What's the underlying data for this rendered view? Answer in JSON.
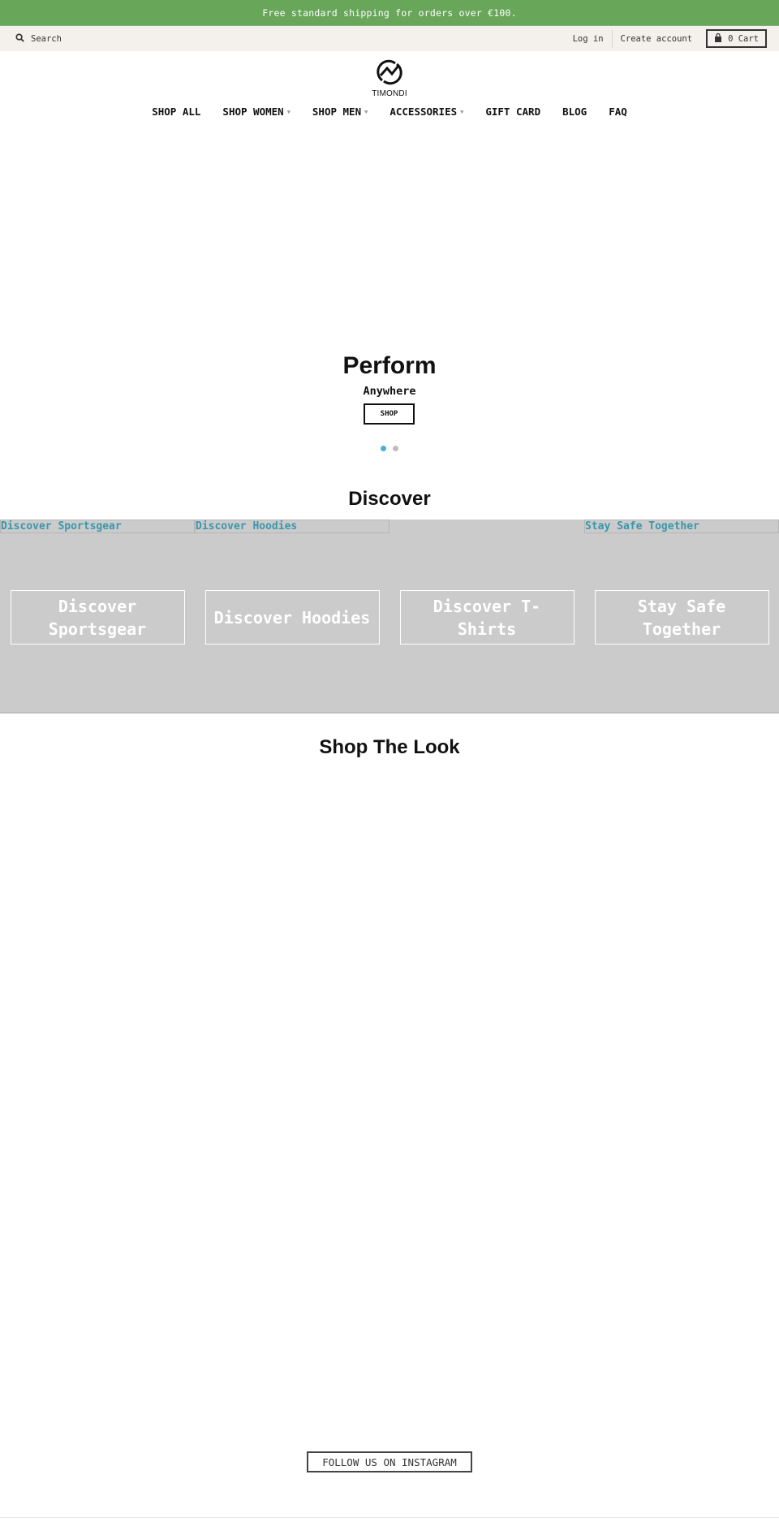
{
  "announcement": {
    "text": "Free standard shipping for orders over €100.",
    "bg_color": "#68a659"
  },
  "utility_bar": {
    "search_label": "Search",
    "search_icon": "search-icon",
    "login_label": "Log in",
    "create_account_label": "Create account",
    "cart_label": "0 Cart",
    "cart_icon": "shopping-bag-icon"
  },
  "logo": {
    "text": "TIMONDI",
    "icon": "timondi-logo-icon"
  },
  "nav": {
    "items": [
      {
        "label": "SHOP ALL",
        "has_dropdown": false
      },
      {
        "label": "SHOP WOMEN",
        "has_dropdown": true
      },
      {
        "label": "SHOP MEN",
        "has_dropdown": true
      },
      {
        "label": "ACCESSORIES",
        "has_dropdown": true
      },
      {
        "label": "GIFT CARD",
        "has_dropdown": false
      },
      {
        "label": "BLOG",
        "has_dropdown": false
      },
      {
        "label": "FAQ",
        "has_dropdown": false
      }
    ],
    "caret": "▼"
  },
  "hero": {
    "title": "Perform",
    "subtitle": "Anywhere",
    "button_label": "SHOP",
    "slides_total": 2,
    "active_slide": 1,
    "active_dot_color": "#4ab0d3"
  },
  "discover": {
    "title": "Discover",
    "collections": [
      {
        "label": "Discover Sportsgear",
        "card_text": "Discover Sportsgear"
      },
      {
        "label": "Discover Hoodies",
        "card_text": "Discover Hoodies"
      },
      {
        "label": "",
        "card_text": "Discover T-Shirts"
      },
      {
        "label": "Stay Safe Together",
        "card_text": "Stay Safe Together"
      }
    ],
    "link_color": "#3a97ac"
  },
  "shop_the_look": {
    "title": "Shop The Look"
  },
  "instagram": {
    "button_label": "FOLLOW US ON INSTAGRAM"
  }
}
